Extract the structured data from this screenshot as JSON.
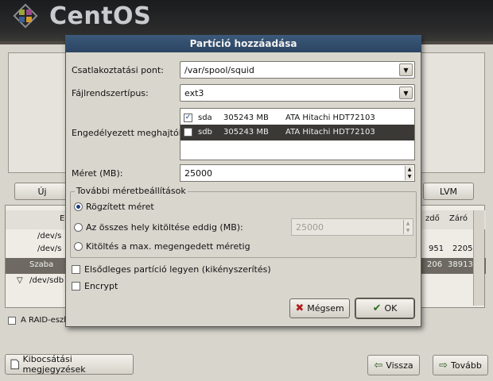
{
  "banner": {
    "product": "CentOS"
  },
  "background": {
    "buttons": {
      "new": "Új",
      "lvm": "LVM"
    },
    "table": {
      "header_device": "E",
      "header_start": "zdő",
      "header_end": "Záró",
      "rows": [
        {
          "device": "/dev/s",
          "start": "",
          "end": ""
        },
        {
          "device": "/dev/s",
          "start": "951",
          "end": "2205"
        },
        {
          "device": "Szaba",
          "start": "206",
          "end": "38913"
        },
        {
          "device": "/dev/sdb",
          "start": "",
          "end": ""
        },
        {
          "device": "",
          "start": "",
          "end": ""
        }
      ]
    },
    "raid_label": "A RAID-eszk",
    "bottom": {
      "release_notes": "Kibocsátási megjegyzések",
      "back": "Vissza",
      "next": "Tovább"
    }
  },
  "dialog": {
    "title": "Partíció hozzáadása",
    "mount_point_label": "Csatlakoztatási pont:",
    "mount_point_value": "/var/spool/squid",
    "fstype_label": "Fájlrendszertípus:",
    "fstype_value": "ext3",
    "drives_label": "Engedélyezett meghajtók:",
    "drives": [
      {
        "checked": true,
        "name": "sda",
        "size": "305243 MB",
        "model": "ATA Hitachi HDT72103"
      },
      {
        "checked": false,
        "name": "sdb",
        "size": "305243 MB",
        "model": "ATA Hitachi HDT72103"
      }
    ],
    "size_label": "Méret (MB):",
    "size_value": "25000",
    "options_title": "További méretbeállítások",
    "opt_fixed": "Rögzített méret",
    "opt_fill_to": "Az összes hely kitöltése eddig (MB):",
    "fill_to_value": "25000",
    "opt_fill_max": "Kitöltés a max. megengedett méretig",
    "selected_option": "fixed",
    "primary_label": "Elsődleges partíció legyen (kikényszerítés)",
    "encrypt_label": "Encrypt",
    "cancel": "Mégsem",
    "ok": "OK"
  }
}
